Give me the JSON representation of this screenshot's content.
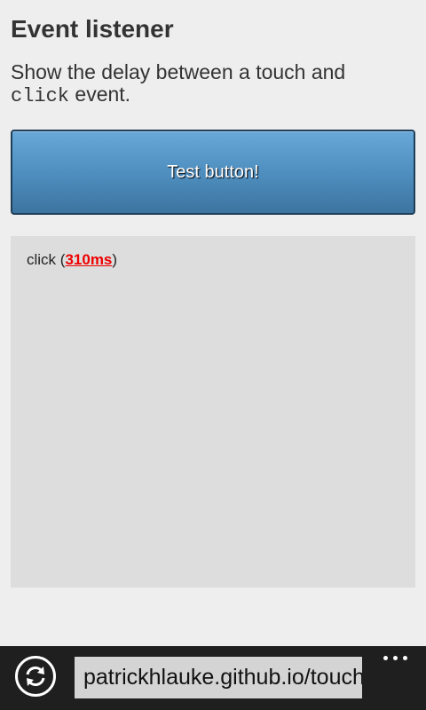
{
  "page": {
    "title": "Event listener",
    "description_before": "Show the delay between a touch and",
    "description_code": "click",
    "description_after": " event."
  },
  "test_button": {
    "label": "Test button!"
  },
  "log": {
    "event_name": "click",
    "open_paren": " (",
    "delay": "310ms",
    "close_paren": ")"
  },
  "browser_bar": {
    "url": "patrickhlauke.github.io/touch/tests/event-listener.html",
    "refresh_icon": "refresh-icon",
    "more_icon": "more-icon"
  },
  "colors": {
    "background": "#eeeeee",
    "button_top": "#67a8d8",
    "button_bottom": "#3d74a0",
    "delay_text": "#ee0000",
    "app_bar": "#1f1f1f"
  }
}
